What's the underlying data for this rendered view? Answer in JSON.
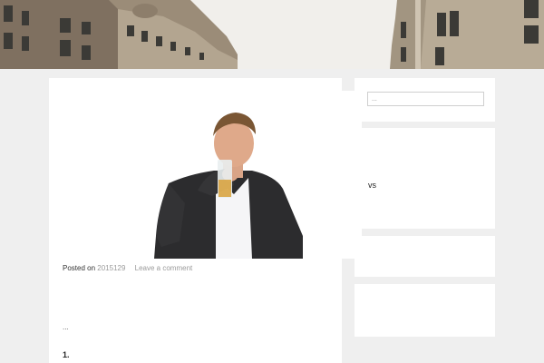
{
  "post": {
    "posted_on_label": "Posted on",
    "date": "2015129",
    "comment_link": "Leave a comment",
    "excerpt": "...",
    "list_number": "1."
  },
  "sidebar": {
    "search": {
      "placeholder": "..."
    },
    "widget_text": "vs"
  },
  "colors": {
    "page_bg": "#efefef",
    "card_bg": "#ffffff",
    "meta_link": "#9a9a9a"
  }
}
